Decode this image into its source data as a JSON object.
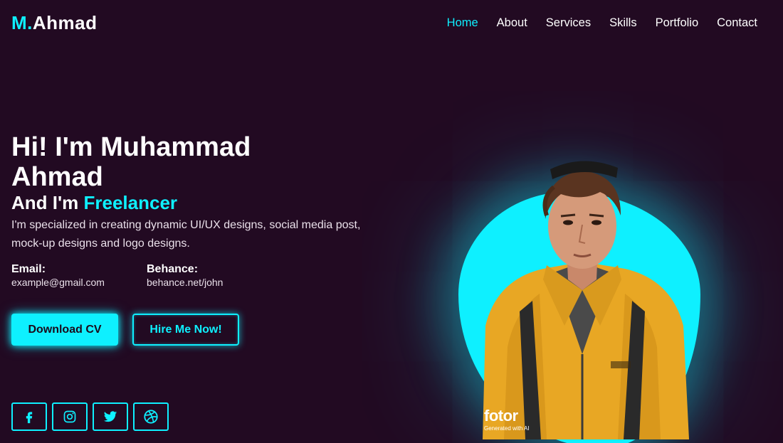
{
  "header": {
    "logo_accent": "M.",
    "logo_name": "Ahmad",
    "nav": [
      {
        "label": "Home",
        "active": true
      },
      {
        "label": "About"
      },
      {
        "label": "Services"
      },
      {
        "label": "Skills"
      },
      {
        "label": "Portfolio"
      },
      {
        "label": "Contact"
      }
    ]
  },
  "hero": {
    "title": "Hi! I'm Muhammad Ahmad",
    "subtitle_prefix": "And I'm ",
    "subtitle_role": "Freelancer",
    "description": "I'm specialized in creating dynamic UI/UX designs, social media post, mock-up designs and logo designs.",
    "email_label": "Email:",
    "email_value": "example@gmail.com",
    "behance_label": "Behance:",
    "behance_value": "behance.net/john"
  },
  "buttons": {
    "download": "Download CV",
    "hire": "Hire Me Now!"
  },
  "socials": [
    {
      "icon": "facebook-icon"
    },
    {
      "icon": "instagram-icon"
    },
    {
      "icon": "twitter-icon"
    },
    {
      "icon": "dribbble-icon"
    }
  ],
  "watermark": {
    "brand": "fotor",
    "note": "Generated with AI"
  },
  "colors": {
    "background": "#220a22",
    "accent": "#0ef0ff",
    "jacket": "#e8a724"
  }
}
